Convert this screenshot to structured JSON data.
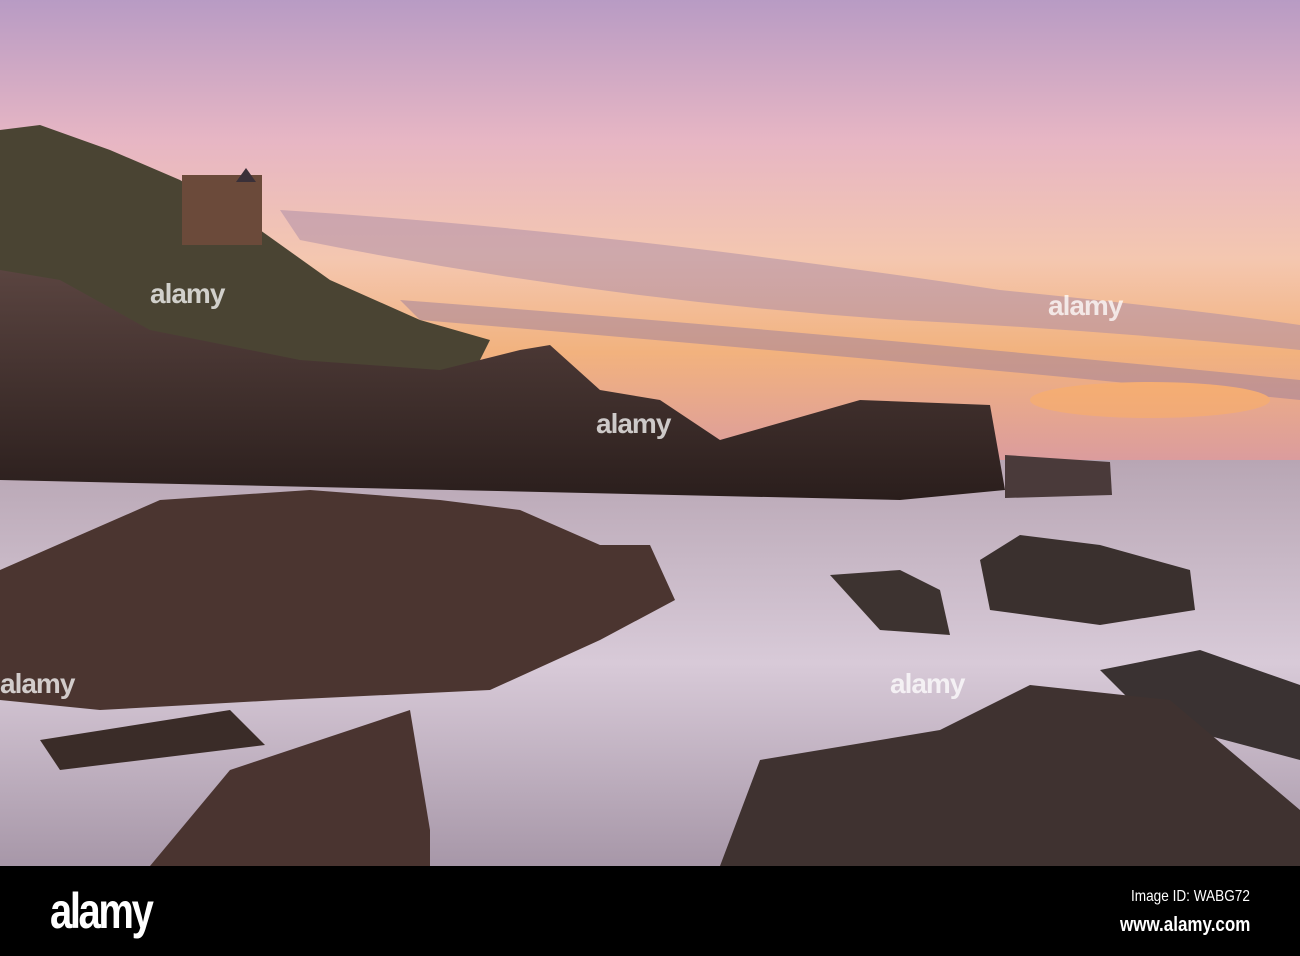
{
  "watermark": {
    "text": "alamy"
  },
  "footer": {
    "logo": "alamy",
    "image_id": "Image ID: WABG72",
    "url": "www.alamy.com"
  }
}
